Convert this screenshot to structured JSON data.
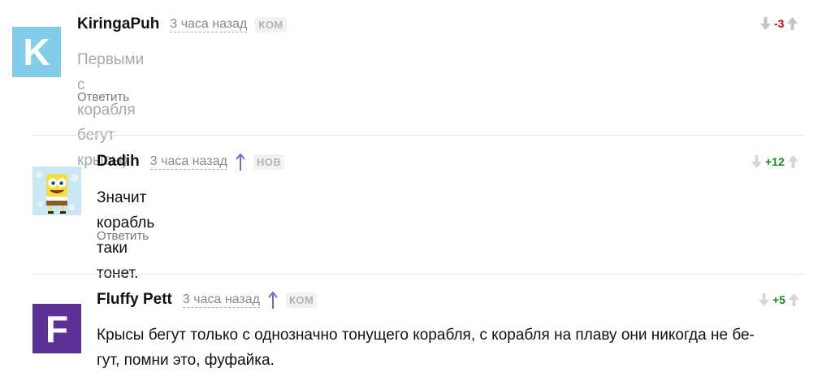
{
  "comments": [
    {
      "username": "KiringaPuh",
      "avatar_letter": "K",
      "avatar_color": "#82cdea",
      "time": "3 часа назад",
      "badge": "КОМ",
      "score": "-3",
      "text": "Первыми с корабля бегут крысы)",
      "reply_label": "Ответить"
    },
    {
      "username": "Dadih",
      "avatar_image": "spongebob-avatar",
      "time": "3 часа назад",
      "badge": "НОВ",
      "score": "+12",
      "text": "Значит корабль таки тонет.",
      "reply_label": "Ответить"
    },
    {
      "username": "Fluffy Pett",
      "avatar_letter": "F",
      "avatar_color": "#5c3196",
      "time": "3 часа назад",
      "badge": "КОМ",
      "score": "+5",
      "text_line1": "Крысы бегут только с однозначно тонущего корабля, с корабля на плаву они никогда не бе-",
      "text_line2": "гут, помни это, фуфайка."
    }
  ],
  "colors": {
    "negative_score": "#d40000",
    "positive_score": "#1a8a1a",
    "reply_arrow": "#6a6fc9"
  },
  "icons": {
    "vote_down": "arrow-down-icon",
    "vote_up": "arrow-up-icon",
    "reply_to": "reply-up-arrow-icon"
  }
}
